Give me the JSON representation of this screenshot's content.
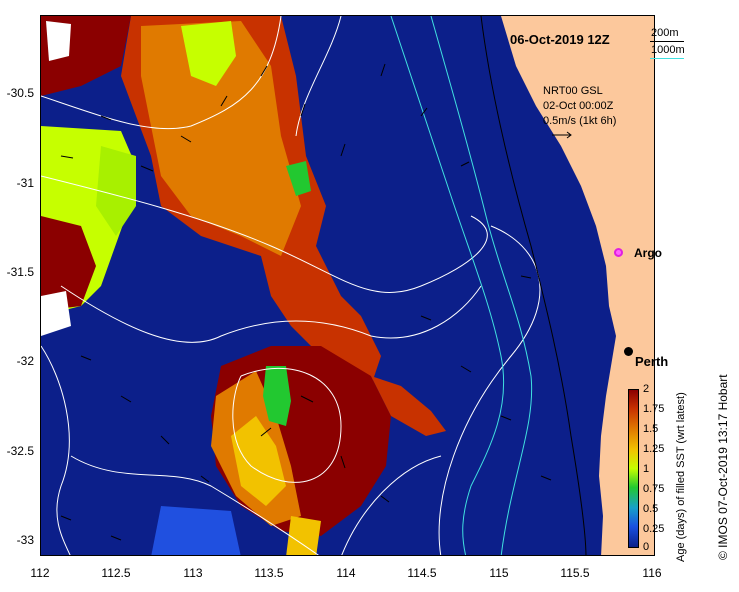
{
  "title": "06-Oct-2019 12Z",
  "legend_depth": {
    "line1": "200m",
    "line2": "1000m",
    "color1": "#000000",
    "color2": "#40e0e0"
  },
  "current_info": {
    "line1": "NRT00 GSL",
    "line2": "02-Oct 00:00Z",
    "line3": "0.5m/s (1kt 6h)"
  },
  "labels": {
    "argo": "Argo",
    "perth": "Perth"
  },
  "colorbar": {
    "title": "Age (days) of filled SST (wrt latest)",
    "ticks": [
      "2",
      "1.75",
      "1.5",
      "1.25",
      "1",
      "0.75",
      "0.5",
      "0.25",
      "0"
    ],
    "colors": [
      "#8b0000",
      "#c83200",
      "#e07a00",
      "#f2c200",
      "#c6ff00",
      "#22c830",
      "#18a0c8",
      "#1a50e0",
      "#0c1f8a"
    ]
  },
  "credit": "© IMOS 07-Oct-2019 13:17 Hobart",
  "axes": {
    "x_ticks": [
      "112",
      "112.5",
      "113",
      "113.5",
      "114",
      "114.5",
      "115",
      "115.5",
      "116"
    ],
    "y_ticks": [
      "-30.5",
      "-31",
      "-31.5",
      "-32",
      "-32.5",
      "-33"
    ]
  },
  "colors": {
    "ocean": "#0c1f8a",
    "land": "#fcc89c",
    "contour": "#ffffff",
    "argo": "#e020e0"
  }
}
